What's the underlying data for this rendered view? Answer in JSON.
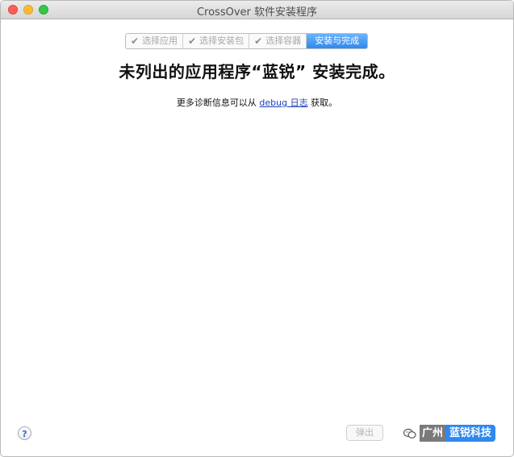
{
  "window": {
    "title": "CrossOver 软件安装程序"
  },
  "steps": [
    {
      "label": "选择应用",
      "done": true,
      "active": false
    },
    {
      "label": "选择安装包",
      "done": true,
      "active": false
    },
    {
      "label": "选择容器",
      "done": true,
      "active": false
    },
    {
      "label": "安装与完成",
      "done": false,
      "active": true
    }
  ],
  "main": {
    "heading": "未列出的应用程序“蓝锐” 安装完成。",
    "info_prefix": "更多诊断信息可以从",
    "info_link": "debug 日志",
    "info_suffix": "获取。"
  },
  "footer": {
    "help_label": "?",
    "eject_label": "弹出",
    "watermark_part1": "广州",
    "watermark_part2": "蓝锐科技"
  },
  "colors": {
    "accent": "#2f88ee",
    "link": "#1b3fb8"
  },
  "icons": {
    "step_done": "checkmark-icon",
    "help": "question-icon",
    "watermark": "wechat-icon"
  }
}
